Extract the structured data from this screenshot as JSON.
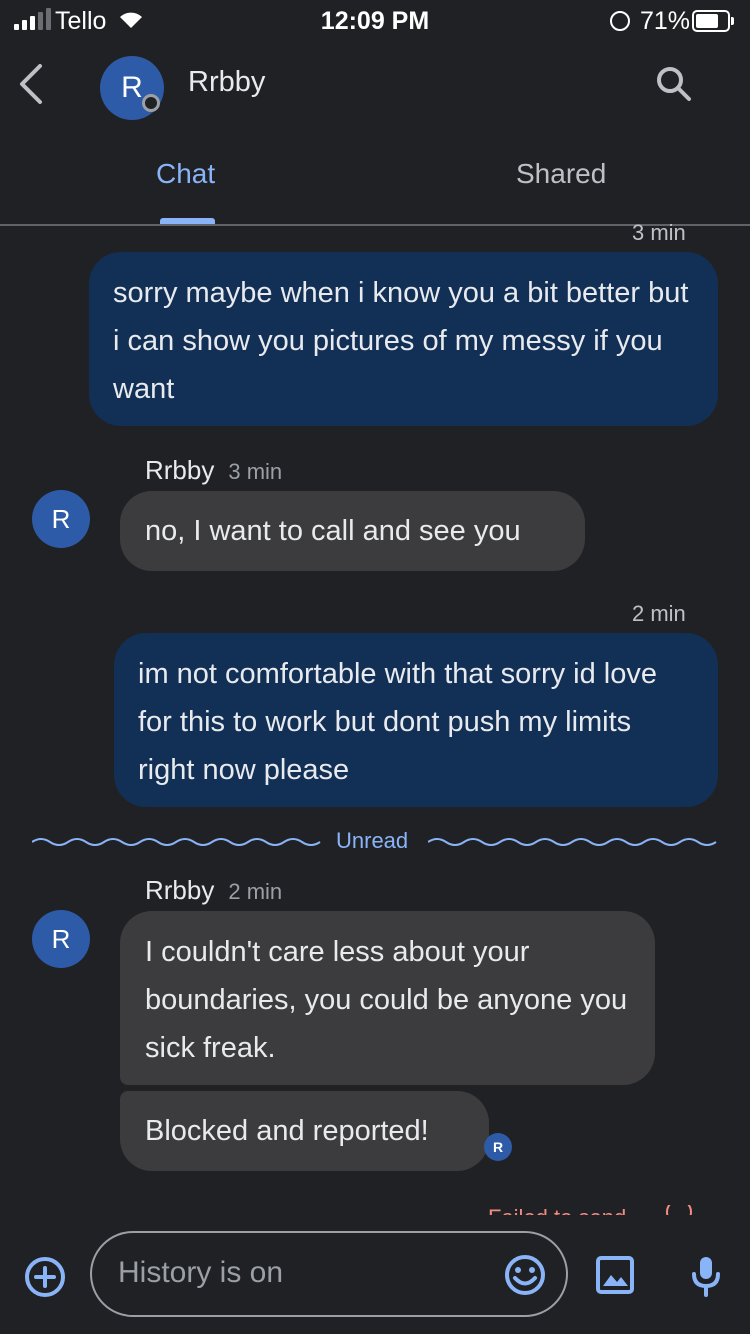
{
  "status_bar": {
    "carrier": "Tello",
    "time": "12:09 PM",
    "battery": "71%"
  },
  "header": {
    "avatar_letter": "R",
    "contact_name": "Rrbby"
  },
  "tabs": [
    {
      "label": "Chat",
      "active": true
    },
    {
      "label": "Shared",
      "active": false
    }
  ],
  "messages": [
    {
      "direction": "outgoing",
      "time": "3 min",
      "text": "sorry maybe when i know you a bit better but i can show you pictures of my messy if you want"
    },
    {
      "direction": "incoming",
      "sender": "Rrbby",
      "time": "3 min",
      "avatar_letter": "R",
      "text": "no, I want to call and see you"
    },
    {
      "direction": "outgoing",
      "time": "2 min",
      "text": "im not comfortable with that sorry id love for this to work but dont push my limits right now please"
    },
    {
      "direction": "incoming",
      "sender": "Rrbby",
      "time": "2 min",
      "avatar_letter": "R",
      "text": "I couldn't care less about your boundaries, you could be anyone you sick freak."
    },
    {
      "direction": "incoming",
      "text": "Blocked and reported!",
      "read_receipt_letter": "R"
    }
  ],
  "unread_divider": "Unread",
  "failed_label": "Failed to send",
  "composer": {
    "placeholder": "History is on"
  },
  "colors": {
    "accent": "#8ab4f8",
    "outgoing_bubble": "#123056",
    "incoming_bubble": "#3c3c3f",
    "avatar": "#2d5ba7",
    "background": "#202124"
  }
}
